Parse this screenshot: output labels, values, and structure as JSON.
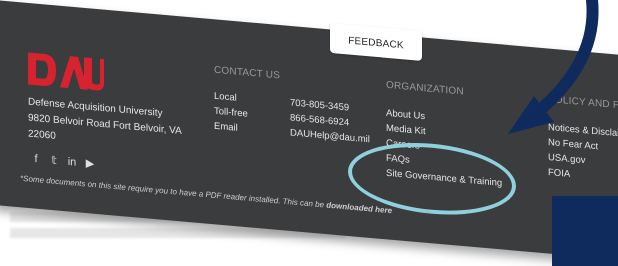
{
  "feedback_tab": {
    "label": "FEEDBACK"
  },
  "brand": {
    "logo_text": "DAU",
    "org_name": "Defense Acquisition University",
    "address_line1": "9820 Belvoir Road Fort Belvoir, VA",
    "address_line2": "22060",
    "accent_color": "#d6232f"
  },
  "social_icons": [
    {
      "name": "facebook-icon",
      "glyph": "f"
    },
    {
      "name": "twitter-icon",
      "glyph": "𝕥"
    },
    {
      "name": "linkedin-icon",
      "glyph": "in"
    },
    {
      "name": "youtube-icon",
      "glyph": "▶"
    }
  ],
  "contact": {
    "heading": "CONTACT US",
    "rows": [
      {
        "label": "Local",
        "value": "703-805-3459"
      },
      {
        "label": "Toll-free",
        "value": "866-568-6924"
      },
      {
        "label": "Email",
        "value": "DAUHelp@dau.mil"
      }
    ]
  },
  "organization": {
    "heading": "ORGANIZATION",
    "links": [
      "About Us",
      "Media Kit",
      "Careers",
      "FAQs",
      "Site Governance & Training"
    ]
  },
  "policies": {
    "heading": "POLICY AND PRIVA",
    "links": [
      "Notices & Disclaime",
      "No Fear Act",
      "USA.gov",
      "FOIA"
    ]
  },
  "pdf_note": {
    "text": "*Some documents on this site require you to have a PDF reader installed. This can be",
    "link": "downloaded here"
  },
  "colors": {
    "footer_bg": "#3b3c3e",
    "highlight": "#8fd0dd",
    "arrow": "#0f2a5c"
  }
}
